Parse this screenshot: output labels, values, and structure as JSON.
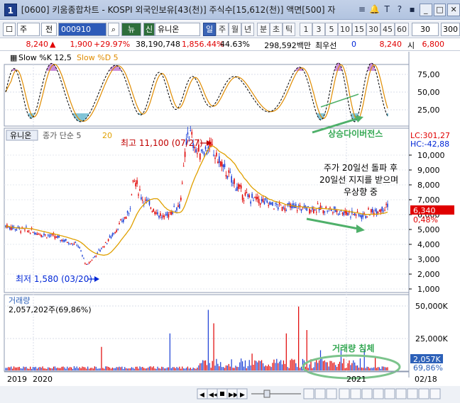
{
  "window": {
    "badge": "1",
    "title": "[0600] 키움종합차트 - KOSPI 외국인보유[43(천)] 주식수[15,612(천)] 액면[500] 자",
    "icons": [
      "chart-list-icon",
      "bell-icon",
      "text-size-icon",
      "help-icon",
      "menu-icon"
    ],
    "icon_glyphs": [
      "≡",
      "🔔",
      "T",
      "?",
      "▪"
    ],
    "buttons": {
      "min": "_",
      "max": "□",
      "close": "✕"
    }
  },
  "toolbar": {
    "checkbox_icon": "☐",
    "market": "주",
    "period_label": "전",
    "code": "000910",
    "new_label": "뉴",
    "credit_label": "신",
    "stock_name": "유니온",
    "period_tabs": [
      "일",
      "주",
      "월",
      "년",
      "분",
      "초",
      "틱"
    ],
    "active_period": "일",
    "intervals": [
      "1",
      "3",
      "5",
      "10",
      "15",
      "30",
      "45",
      "60"
    ],
    "interval_value": "30",
    "count_value": "300"
  },
  "quote": {
    "price": "8,240",
    "arrow": "▲",
    "change": "1,900",
    "change_pct": "+29.97%",
    "volume": "38,190,748",
    "volume_ratio": "1,856.44%",
    "turnover": "44.63%",
    "amount": "298,592백만",
    "pref_label": "최우선",
    "pref_value": "0",
    "ask": "8,240",
    "open_label": "시",
    "open": "6,800",
    "colors": {
      "up": "#e00000",
      "down": "#0026d6",
      "text": "#000000"
    }
  },
  "stochastic": {
    "label_k": "Slow %K 12,5",
    "label_d": "Slow %D 5",
    "scale": [
      "75,00",
      "50,00",
      "25,00"
    ],
    "annotation": "상승다이버전스"
  },
  "price_panel": {
    "name_tag": "유니온",
    "ma_label": "종가 단순 5",
    "ma_period": "20",
    "high_label": "최고 11,100 (07/27)",
    "low_label": "최저 1,580 (03/20)",
    "lc": "LC:301,27",
    "hc": "HC:-42,88",
    "scale": [
      "10,000",
      "9,000",
      "8,000",
      "7,000",
      "6,000",
      "5,000",
      "4,000",
      "3,000",
      "2,000",
      "1,000"
    ],
    "current_price": "6,340",
    "current_pct": "0,48%",
    "note_line1": "주가 20일선 돌파 후",
    "note_line2": "20일선 지지를 받으며",
    "note_line3": "우상향 중"
  },
  "volume_panel": {
    "label": "거래량",
    "value": "2,057,202주(69,86%)",
    "scale": [
      "50,000K",
      "25,000K"
    ],
    "current": "2,057K",
    "current_pct": "69,86%",
    "annotation": "거래량 침체"
  },
  "xaxis": {
    "labels": [
      "2019",
      "2020",
      "2021",
      "02/18"
    ]
  },
  "colors": {
    "up": "#e00000",
    "down": "#1a3fd6",
    "ma": "#e0a000",
    "stoch_k": "#000000",
    "stoch_d": "#e08c00",
    "annotation_green": "#34a853",
    "oversold_fill": "#7fc3d6",
    "overbought_fill": "#c98ad9"
  }
}
